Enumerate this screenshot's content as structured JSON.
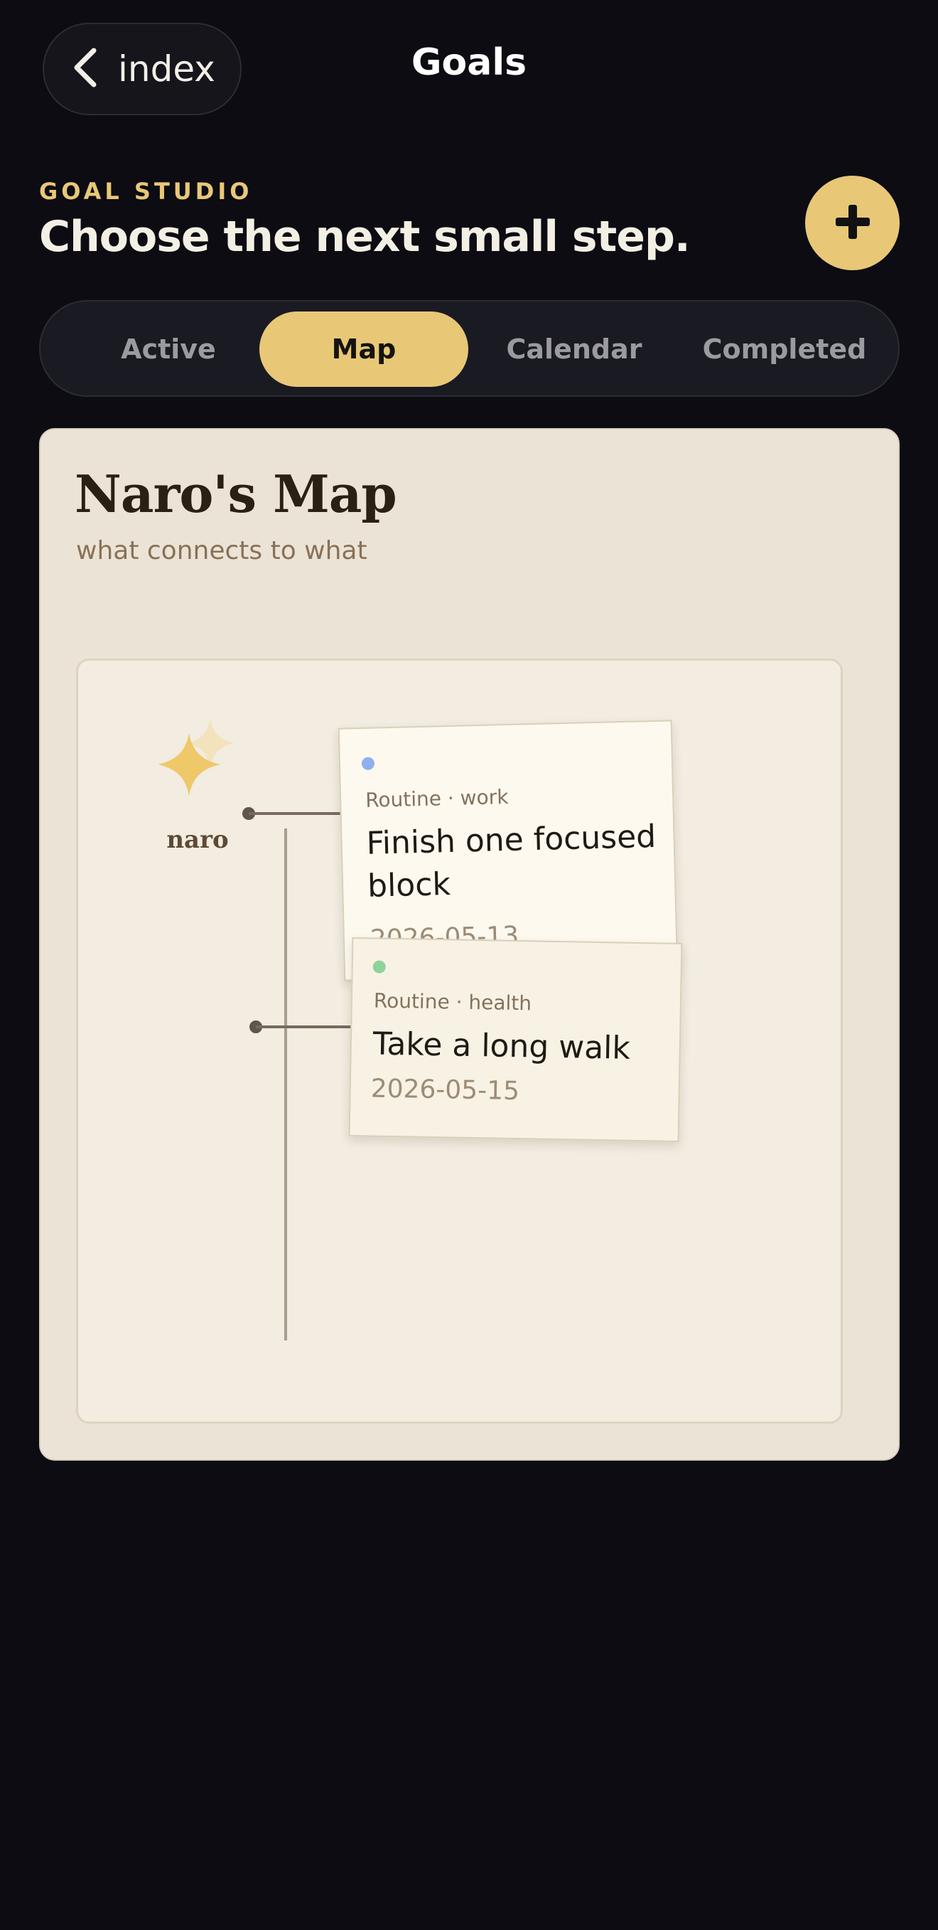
{
  "header": {
    "back_label": "index",
    "title": "Goals"
  },
  "studio": {
    "eyebrow": "GOAL STUDIO",
    "headline": "Choose the next small step.",
    "add_icon": "plus-icon"
  },
  "tabs": [
    {
      "label": "Active",
      "selected": false
    },
    {
      "label": "Map",
      "selected": true
    },
    {
      "label": "Calendar",
      "selected": false
    },
    {
      "label": "Completed",
      "selected": false
    }
  ],
  "map": {
    "title": "Naro's Map",
    "subtitle": "what connects to what",
    "root": {
      "label": "naro",
      "icon": "sparkle-star-icon"
    },
    "goals": [
      {
        "category": "Routine · work",
        "title": "Finish one focused block",
        "date": "2026-05-13",
        "dot_color": "#8fb0ee"
      },
      {
        "category": "Routine · health",
        "title": "Take a long walk",
        "date": "2026-05-15",
        "dot_color": "#8fd39a"
      }
    ]
  },
  "colors": {
    "background": "#0c0c12",
    "accent": "#e8c777",
    "card": "#ebe4d6"
  }
}
